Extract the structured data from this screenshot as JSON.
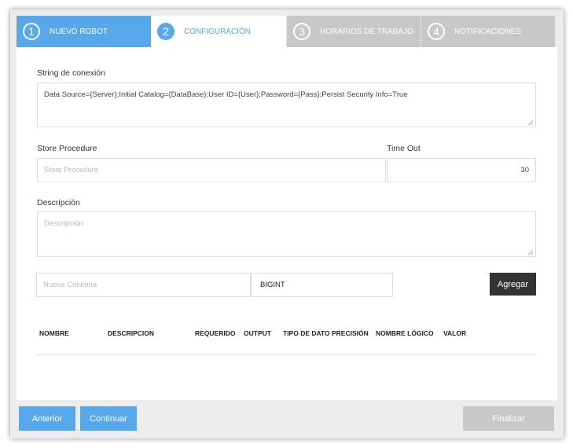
{
  "wizard": {
    "steps": [
      {
        "number": "1",
        "label": "NUEVO ROBOT",
        "state": "done"
      },
      {
        "number": "2",
        "label": "CONFIGURACIÓN",
        "state": "active"
      },
      {
        "number": "3",
        "label": "HORARIOS DE TRABAJO",
        "state": "todo"
      },
      {
        "number": "4",
        "label": "NOTIFICACIONES",
        "state": "todo"
      }
    ]
  },
  "form": {
    "connection_label": "String de conexión",
    "connection_value": "Data Source={Server};Initial Catalog={DataBase};User ID={User};Password={Pass};Persist Security Info=True",
    "store_procedure_label": "Store Procedure",
    "store_procedure_placeholder": "Store Procedure",
    "timeout_label": "Time Out",
    "timeout_value": "30",
    "description_label": "Descripción",
    "description_placeholder": "Descripción",
    "new_column_placeholder": "Nueva Columna",
    "datatype_value": "BIGINT",
    "add_button": "Agregar"
  },
  "table": {
    "headers": [
      "NOMBRE",
      "DESCRIPCION",
      "REQUERIDO",
      "OUTPUT",
      "TIPO DE DATO",
      "PRECISIÓN",
      "NOMBRE LÓGICO",
      "VALOR"
    ]
  },
  "footer": {
    "previous": "Anterior",
    "next": "Continuar",
    "finish": "Finalizar"
  },
  "colors": {
    "primary": "#56a8eb",
    "dark_button": "#333333",
    "disabled": "#c8c8c8"
  }
}
